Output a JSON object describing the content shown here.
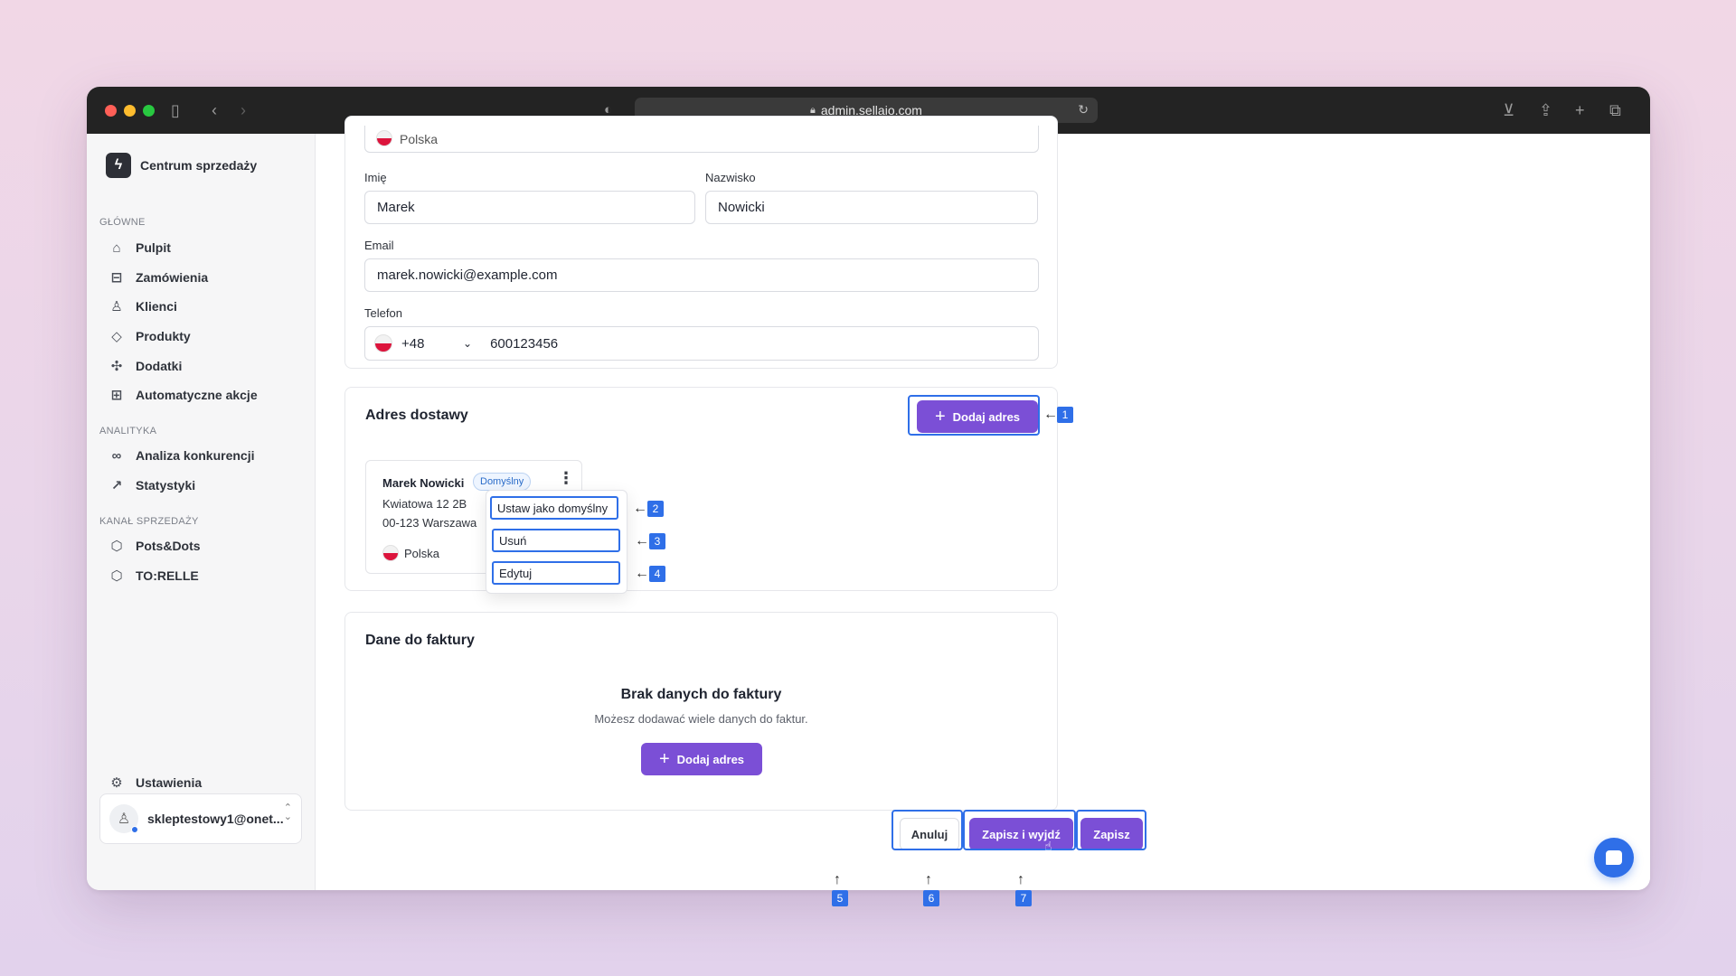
{
  "browser": {
    "url": "admin.sellaio.com"
  },
  "sidebar": {
    "brand": "Centrum sprzedaży",
    "sections": [
      {
        "label": "GŁÓWNE"
      },
      {
        "label": "ANALITYKA"
      },
      {
        "label": "KANAŁ SPRZEDAŻY"
      }
    ],
    "items": [
      {
        "label": "Pulpit",
        "icon": "home-icon"
      },
      {
        "label": "Zamówienia",
        "icon": "inbox-icon"
      },
      {
        "label": "Klienci",
        "icon": "user-icon"
      },
      {
        "label": "Produkty",
        "icon": "tag-icon"
      },
      {
        "label": "Dodatki",
        "icon": "puzzle-icon"
      },
      {
        "label": "Automatyczne akcje",
        "icon": "workflow-icon"
      },
      {
        "label": "Analiza konkurencji",
        "icon": "binoculars-icon"
      },
      {
        "label": "Statystyki",
        "icon": "trending-up-icon"
      },
      {
        "label": "Pots&Dots",
        "icon": "store-icon"
      },
      {
        "label": "TO:RELLE",
        "icon": "store-icon"
      }
    ],
    "settings": "Ustawienia",
    "user": "skleptestowy1@onet..."
  },
  "form": {
    "country_value": "Polska",
    "first_name_label": "Imię",
    "first_name_value": "Marek",
    "last_name_label": "Nazwisko",
    "last_name_value": "Nowicki",
    "email_label": "Email",
    "email_value": "marek.nowicki@example.com",
    "phone_label": "Telefon",
    "phone_code": "+48",
    "phone_value": "600123456"
  },
  "shipping": {
    "title": "Adres dostawy",
    "add_button": "Dodaj adres",
    "address": {
      "name": "Marek Nowicki",
      "badge": "Domyślny",
      "street": "Kwiatowa 12 2B",
      "city": "00-123 Warszawa",
      "country": "Polska"
    },
    "menu": [
      "Ustaw jako domyślny",
      "Usuń",
      "Edytuj"
    ]
  },
  "invoice": {
    "title": "Dane do faktury",
    "empty_title": "Brak danych do faktury",
    "empty_sub": "Możesz dodawać wiele danych do faktur.",
    "add_button": "Dodaj adres"
  },
  "footer": {
    "cancel": "Anuluj",
    "save_exit": "Zapisz i wyjdź",
    "save": "Zapisz"
  },
  "annotations": [
    "1",
    "2",
    "3",
    "4",
    "5",
    "6",
    "7"
  ],
  "colors": {
    "accent": "#7b4fd6",
    "annotation": "#2f6fe8"
  }
}
